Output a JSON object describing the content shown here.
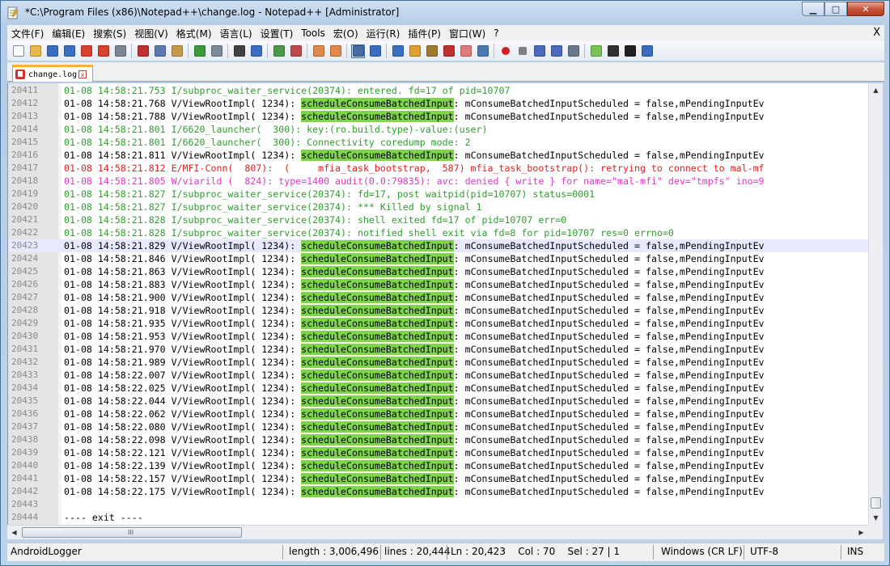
{
  "window": {
    "title": "*C:\\Program Files (x86)\\Notepad++\\change.log - Notepad++ [Administrator]",
    "buttons": {
      "minimize": "▁",
      "maximize": "□",
      "close": "✕"
    }
  },
  "menu": {
    "items": [
      "文件(F)",
      "编辑(E)",
      "搜索(S)",
      "视图(V)",
      "格式(M)",
      "语言(L)",
      "设置(T)",
      "Tools",
      "宏(O)",
      "运行(R)",
      "插件(P)",
      "窗口(W)",
      "?"
    ],
    "close_label": "X"
  },
  "toolbar": {
    "icons": [
      "new-file-icon",
      "open-file-icon",
      "save-icon",
      "save-all-icon",
      "close-file-icon",
      "close-all-icon",
      "print-icon",
      "|",
      "cut-icon",
      "copy-icon",
      "paste-icon",
      "|",
      "undo-icon",
      "redo-icon",
      "|",
      "find-icon",
      "replace-icon",
      "|",
      "zoom-in-icon",
      "zoom-out-icon",
      "|",
      "sync-vertical-icon",
      "sync-horizontal-icon",
      "|",
      "word-wrap-icon",
      "show-all-chars-icon",
      "|",
      "indent-guide-icon",
      "user-language-icon",
      "document-map-icon",
      "function-list-icon",
      "folder-workspace-icon",
      "monitoring-icon",
      "|",
      "record-macro-icon",
      "stop-macro-icon",
      "play-macro-icon",
      "run-macro-multiple-icon",
      "save-macro-icon",
      "|",
      "android-icon",
      "device-icon",
      "console-icon",
      "settings-icon"
    ],
    "icon_colors": {
      "new-file-icon": "#ffffff",
      "open-file-icon": "#e8b84a",
      "save-icon": "#3a6ec0",
      "save-all-icon": "#3a6ec0",
      "close-file-icon": "#d84030",
      "close-all-icon": "#d84030",
      "print-icon": "#7a8694",
      "cut-icon": "#c03030",
      "copy-icon": "#5a7ab0",
      "paste-icon": "#c49a4a",
      "undo-icon": "#3a9a3a",
      "redo-icon": "#7a8a9a",
      "find-icon": "#404040",
      "replace-icon": "#3a6ec0",
      "zoom-in-icon": "#4a9a4a",
      "zoom-out-icon": "#c04a4a",
      "sync-vertical-icon": "#e0884a",
      "sync-horizontal-icon": "#e0884a",
      "word-wrap-icon": "#4a6aa0",
      "show-all-chars-icon": "#3a6ec0",
      "indent-guide-icon": "#3a6ec0",
      "user-language-icon": "#e0a030",
      "document-map-icon": "#a07a30",
      "function-list-icon": "#c03030",
      "folder-workspace-icon": "#e07a7a",
      "monitoring-icon": "#4a7ab0",
      "record-macro-icon": "#d02020",
      "stop-macro-icon": "#808080",
      "play-macro-icon": "#4a6ac0",
      "run-macro-multiple-icon": "#4a6ac0",
      "save-macro-icon": "#6a7a8a",
      "android-icon": "#78c257",
      "device-icon": "#303030",
      "console-icon": "#202020",
      "settings-icon": "#3a6ec0"
    }
  },
  "tab": {
    "label": "change.log",
    "close": "x"
  },
  "editor": {
    "lines": [
      {
        "num": "20411",
        "color": "green",
        "pre": "01-08 14:58:21.753 I/subproc_waiter_service(20374): entered. fd=17 of pid=10707",
        "hl": "",
        "post": ""
      },
      {
        "num": "20412",
        "color": "black",
        "pre": "01-08 14:58:21.768 V/ViewRootImpl( 1234): ",
        "hl": "scheduleConsumeBatchedInput",
        "post": ": mConsumeBatchedInputScheduled = false,mPendingInputEv"
      },
      {
        "num": "20413",
        "color": "black",
        "pre": "01-08 14:58:21.788 V/ViewRootImpl( 1234): ",
        "hl": "scheduleConsumeBatchedInput",
        "post": ": mConsumeBatchedInputScheduled = false,mPendingInputEv"
      },
      {
        "num": "20414",
        "color": "green",
        "pre": "01-08 14:58:21.801 I/6620_launcher(  300): key:(ro.build.type)-value:(user)",
        "hl": "",
        "post": ""
      },
      {
        "num": "20415",
        "color": "green",
        "pre": "01-08 14:58:21.801 I/6620_launcher(  300): Connectivity coredump mode: 2",
        "hl": "",
        "post": ""
      },
      {
        "num": "20416",
        "color": "black",
        "pre": "01-08 14:58:21.811 V/ViewRootImpl( 1234): ",
        "hl": "scheduleConsumeBatchedInput",
        "post": ": mConsumeBatchedInputScheduled = false,mPendingInputEv"
      },
      {
        "num": "20417",
        "color": "red",
        "pre": "01-08 14:58:21.812 E/MFI-Conn(  807):  (     mfia_task_bootstrap,  587) mfia_task_bootstrap(): retrying to connect to mal-mf",
        "hl": "",
        "post": ""
      },
      {
        "num": "20418",
        "color": "pink",
        "pre": "01-08 14:58:21.805 W/viarild (  824): type=1400 audit(0.0:79835): avc: denied { write } for name=\"mal-mfi\" dev=\"tmpfs\" ino=9",
        "hl": "",
        "post": ""
      },
      {
        "num": "20419",
        "color": "green",
        "pre": "01-08 14:58:21.827 I/subproc_waiter_service(20374): fd=17, post waitpid(pid=10707) status=0001",
        "hl": "",
        "post": ""
      },
      {
        "num": "20420",
        "color": "green",
        "pre": "01-08 14:58:21.827 I/subproc_waiter_service(20374): *** Killed by signal 1",
        "hl": "",
        "post": ""
      },
      {
        "num": "20421",
        "color": "green",
        "pre": "01-08 14:58:21.828 I/subproc_waiter_service(20374): shell exited fd=17 of pid=10707 err=0",
        "hl": "",
        "post": ""
      },
      {
        "num": "20422",
        "color": "green",
        "pre": "01-08 14:58:21.828 I/subproc_waiter_service(20374): notified shell exit via fd=8 for pid=10707 res=0 errno=0",
        "hl": "",
        "post": ""
      },
      {
        "num": "20423",
        "color": "black",
        "current": true,
        "pre": "01-08 14:58:21.829 V/ViewRootImpl( 1234): ",
        "hl": "scheduleConsumeBatchedInput",
        "post": ": mConsumeBatchedInputScheduled = false,mPendingInputEv"
      },
      {
        "num": "20424",
        "color": "black",
        "pre": "01-08 14:58:21.846 V/ViewRootImpl( 1234): ",
        "hl": "scheduleConsumeBatchedInput",
        "post": ": mConsumeBatchedInputScheduled = false,mPendingInputEv"
      },
      {
        "num": "20425",
        "color": "black",
        "pre": "01-08 14:58:21.863 V/ViewRootImpl( 1234): ",
        "hl": "scheduleConsumeBatchedInput",
        "post": ": mConsumeBatchedInputScheduled = false,mPendingInputEv"
      },
      {
        "num": "20426",
        "color": "black",
        "pre": "01-08 14:58:21.883 V/ViewRootImpl( 1234): ",
        "hl": "scheduleConsumeBatchedInput",
        "post": ": mConsumeBatchedInputScheduled = false,mPendingInputEv"
      },
      {
        "num": "20427",
        "color": "black",
        "pre": "01-08 14:58:21.900 V/ViewRootImpl( 1234): ",
        "hl": "scheduleConsumeBatchedInput",
        "post": ": mConsumeBatchedInputScheduled = false,mPendingInputEv"
      },
      {
        "num": "20428",
        "color": "black",
        "pre": "01-08 14:58:21.918 V/ViewRootImpl( 1234): ",
        "hl": "scheduleConsumeBatchedInput",
        "post": ": mConsumeBatchedInputScheduled = false,mPendingInputEv"
      },
      {
        "num": "20429",
        "color": "black",
        "pre": "01-08 14:58:21.935 V/ViewRootImpl( 1234): ",
        "hl": "scheduleConsumeBatchedInput",
        "post": ": mConsumeBatchedInputScheduled = false,mPendingInputEv"
      },
      {
        "num": "20430",
        "color": "black",
        "pre": "01-08 14:58:21.953 V/ViewRootImpl( 1234): ",
        "hl": "scheduleConsumeBatchedInput",
        "post": ": mConsumeBatchedInputScheduled = false,mPendingInputEv"
      },
      {
        "num": "20431",
        "color": "black",
        "pre": "01-08 14:58:21.970 V/ViewRootImpl( 1234): ",
        "hl": "scheduleConsumeBatchedInput",
        "post": ": mConsumeBatchedInputScheduled = false,mPendingInputEv"
      },
      {
        "num": "20432",
        "color": "black",
        "pre": "01-08 14:58:21.989 V/ViewRootImpl( 1234): ",
        "hl": "scheduleConsumeBatchedInput",
        "post": ": mConsumeBatchedInputScheduled = false,mPendingInputEv"
      },
      {
        "num": "20433",
        "color": "black",
        "pre": "01-08 14:58:22.007 V/ViewRootImpl( 1234): ",
        "hl": "scheduleConsumeBatchedInput",
        "post": ": mConsumeBatchedInputScheduled = false,mPendingInputEv"
      },
      {
        "num": "20434",
        "color": "black",
        "pre": "01-08 14:58:22.025 V/ViewRootImpl( 1234): ",
        "hl": "scheduleConsumeBatchedInput",
        "post": ": mConsumeBatchedInputScheduled = false,mPendingInputEv"
      },
      {
        "num": "20435",
        "color": "black",
        "pre": "01-08 14:58:22.044 V/ViewRootImpl( 1234): ",
        "hl": "scheduleConsumeBatchedInput",
        "post": ": mConsumeBatchedInputScheduled = false,mPendingInputEv"
      },
      {
        "num": "20436",
        "color": "black",
        "pre": "01-08 14:58:22.062 V/ViewRootImpl( 1234): ",
        "hl": "scheduleConsumeBatchedInput",
        "post": ": mConsumeBatchedInputScheduled = false,mPendingInputEv"
      },
      {
        "num": "20437",
        "color": "black",
        "pre": "01-08 14:58:22.080 V/ViewRootImpl( 1234): ",
        "hl": "scheduleConsumeBatchedInput",
        "post": ": mConsumeBatchedInputScheduled = false,mPendingInputEv"
      },
      {
        "num": "20438",
        "color": "black",
        "pre": "01-08 14:58:22.098 V/ViewRootImpl( 1234): ",
        "hl": "scheduleConsumeBatchedInput",
        "post": ": mConsumeBatchedInputScheduled = false,mPendingInputEv"
      },
      {
        "num": "20439",
        "color": "black",
        "pre": "01-08 14:58:22.121 V/ViewRootImpl( 1234): ",
        "hl": "scheduleConsumeBatchedInput",
        "post": ": mConsumeBatchedInputScheduled = false,mPendingInputEv"
      },
      {
        "num": "20440",
        "color": "black",
        "pre": "01-08 14:58:22.139 V/ViewRootImpl( 1234): ",
        "hl": "scheduleConsumeBatchedInput",
        "post": ": mConsumeBatchedInputScheduled = false,mPendingInputEv"
      },
      {
        "num": "20441",
        "color": "black",
        "pre": "01-08 14:58:22.157 V/ViewRootImpl( 1234): ",
        "hl": "scheduleConsumeBatchedInput",
        "post": ": mConsumeBatchedInputScheduled = false,mPendingInputEv"
      },
      {
        "num": "20442",
        "color": "black",
        "pre": "01-08 14:58:22.175 V/ViewRootImpl( 1234): ",
        "hl": "scheduleConsumeBatchedInput",
        "post": ": mConsumeBatchedInputScheduled = false,mPendingInputEv"
      },
      {
        "num": "20443",
        "color": "black",
        "pre": "",
        "hl": "",
        "post": ""
      },
      {
        "num": "20444",
        "color": "black",
        "pre": "---- exit ----",
        "hl": "",
        "post": ""
      }
    ]
  },
  "status": {
    "language": "AndroidLogger",
    "length": "length : 3,006,496",
    "lines": "lines : 20,444",
    "position": "Ln : 20,423    Col : 70    Sel : 27 | 1",
    "eol": "Windows (CR LF)",
    "encoding": "UTF-8",
    "mode": "INS"
  },
  "scrollbar": {
    "grip": "III",
    "up": "▲",
    "down": "▼",
    "left": "◀",
    "right": "▶"
  }
}
